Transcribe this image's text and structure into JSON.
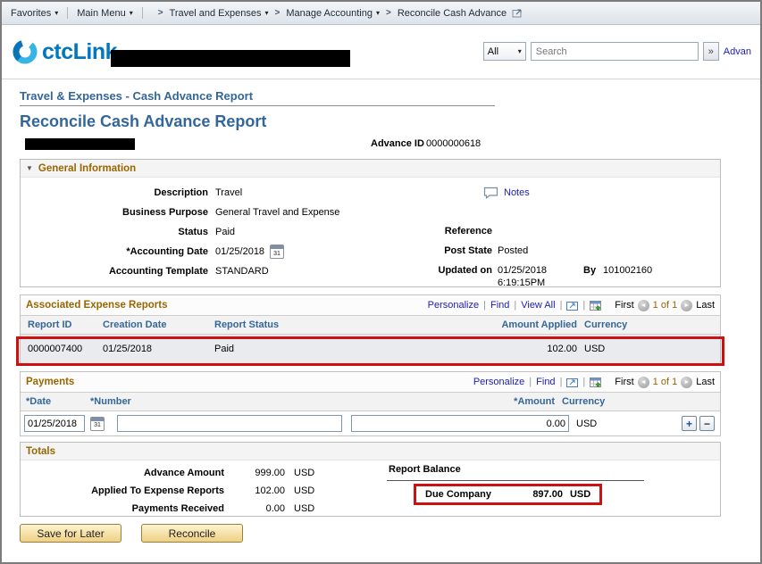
{
  "icons": {
    "caret_down": "▾",
    "breadcrumb_sep": ">",
    "collapse_triangle": "▼",
    "nav_prev": "◄",
    "nav_next": "►",
    "add": "+",
    "remove": "−",
    "search_go": "»",
    "calendar_day": "31",
    "pipe": "|"
  },
  "breadcrumb": {
    "favorites": "Favorites",
    "main_menu": "Main Menu",
    "path": [
      "Travel and Expenses",
      "Manage Accounting",
      "Reconcile Cash Advance"
    ]
  },
  "header": {
    "logo_text": "ctcLink",
    "search_scope": "All",
    "search_placeholder": "Search",
    "advanced_label": "Advan"
  },
  "page": {
    "subtitle": "Travel & Expenses - Cash Advance Report",
    "title": "Reconcile Cash Advance Report",
    "advance_id_label": "Advance ID",
    "advance_id_value": "0000000618"
  },
  "general_info": {
    "section_title": "General Information",
    "fields": {
      "description_label": "Description",
      "description": "Travel",
      "business_purpose_label": "Business Purpose",
      "business_purpose": "General Travel and Expense",
      "status_label": "Status",
      "status": "Paid",
      "accounting_date_label": "*Accounting Date",
      "accounting_date": "01/25/2018",
      "accounting_template_label": "Accounting Template",
      "accounting_template": "STANDARD"
    },
    "right": {
      "notes_label": "Notes",
      "reference_label": "Reference",
      "post_state_label": "Post State",
      "post_state": "Posted",
      "updated_on_label": "Updated on",
      "updated_date": "01/25/2018",
      "updated_time": "6:19:15PM",
      "by_label": "By",
      "updated_by": "101002160"
    }
  },
  "expense_reports": {
    "section_title": "Associated Expense Reports",
    "toolbar": {
      "personalize": "Personalize",
      "find": "Find",
      "view_all": "View All",
      "first": "First",
      "page": "1 of 1",
      "last": "Last"
    },
    "columns": [
      "Report ID",
      "Creation Date",
      "Report Status",
      "Amount Applied",
      "Currency"
    ],
    "rows": [
      {
        "report_id": "0000007400",
        "creation_date": "01/25/2018",
        "report_status": "Paid",
        "amount_applied": "102.00",
        "currency": "USD"
      }
    ]
  },
  "payments": {
    "section_title": "Payments",
    "toolbar": {
      "personalize": "Personalize",
      "find": "Find",
      "first": "First",
      "page": "1 of 1",
      "last": "Last"
    },
    "columns": [
      "*Date",
      "*Number",
      "*Amount",
      "Currency"
    ],
    "row": {
      "date": "01/25/2018",
      "number": "",
      "amount": "0.00",
      "currency": "USD"
    }
  },
  "totals": {
    "section_title": "Totals",
    "rows": [
      {
        "label": "Advance Amount",
        "value": "999.00",
        "currency": "USD"
      },
      {
        "label": "Applied To Expense Reports",
        "value": "102.00",
        "currency": "USD"
      },
      {
        "label": "Payments Received",
        "value": "0.00",
        "currency": "USD"
      }
    ],
    "report_balance_label": "Report Balance",
    "due_company_label": "Due Company",
    "due_company_value": "897.00",
    "due_company_currency": "USD"
  },
  "actions": {
    "save_for_later": "Save for Later",
    "reconcile": "Reconcile"
  },
  "colors": {
    "accent_orange": "#996600",
    "heading_blue": "#336699",
    "link_blue": "#1b1bbd",
    "annotation_red": "#cc1111"
  }
}
